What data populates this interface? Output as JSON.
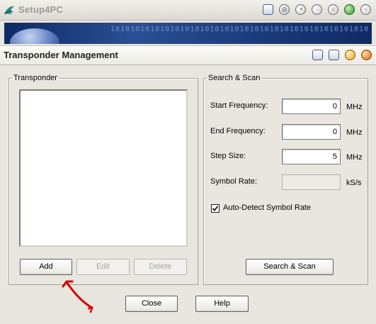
{
  "app": {
    "title": "Setup4PC",
    "banner_bits": "1010101010101010101010101010101010101010101010101010"
  },
  "dialog": {
    "title": "Transponder Management"
  },
  "transponder": {
    "group_label": "Transponder",
    "items": [],
    "add_label": "Add",
    "edit_label": "Edit",
    "delete_label": "Delete"
  },
  "scan": {
    "group_label": "Search & Scan",
    "start_frequency_label": "Start Frequency:",
    "start_frequency_value": "0",
    "end_frequency_label": "End Frequency:",
    "end_frequency_value": "0",
    "step_size_label": "Step Size:",
    "step_size_value": "5",
    "symbol_rate_label": "Symbol Rate:",
    "symbol_rate_value": "",
    "unit_mhz": "MHz",
    "unit_ksps": "kS/s",
    "auto_detect_label": "Auto-Detect Symbol Rate",
    "auto_detect_checked": true,
    "search_scan_label": "Search & Scan"
  },
  "footer": {
    "close_label": "Close",
    "help_label": "Help"
  },
  "colors": {
    "annotation_arrow": "#d80000",
    "banner": "#1b3a7a"
  }
}
